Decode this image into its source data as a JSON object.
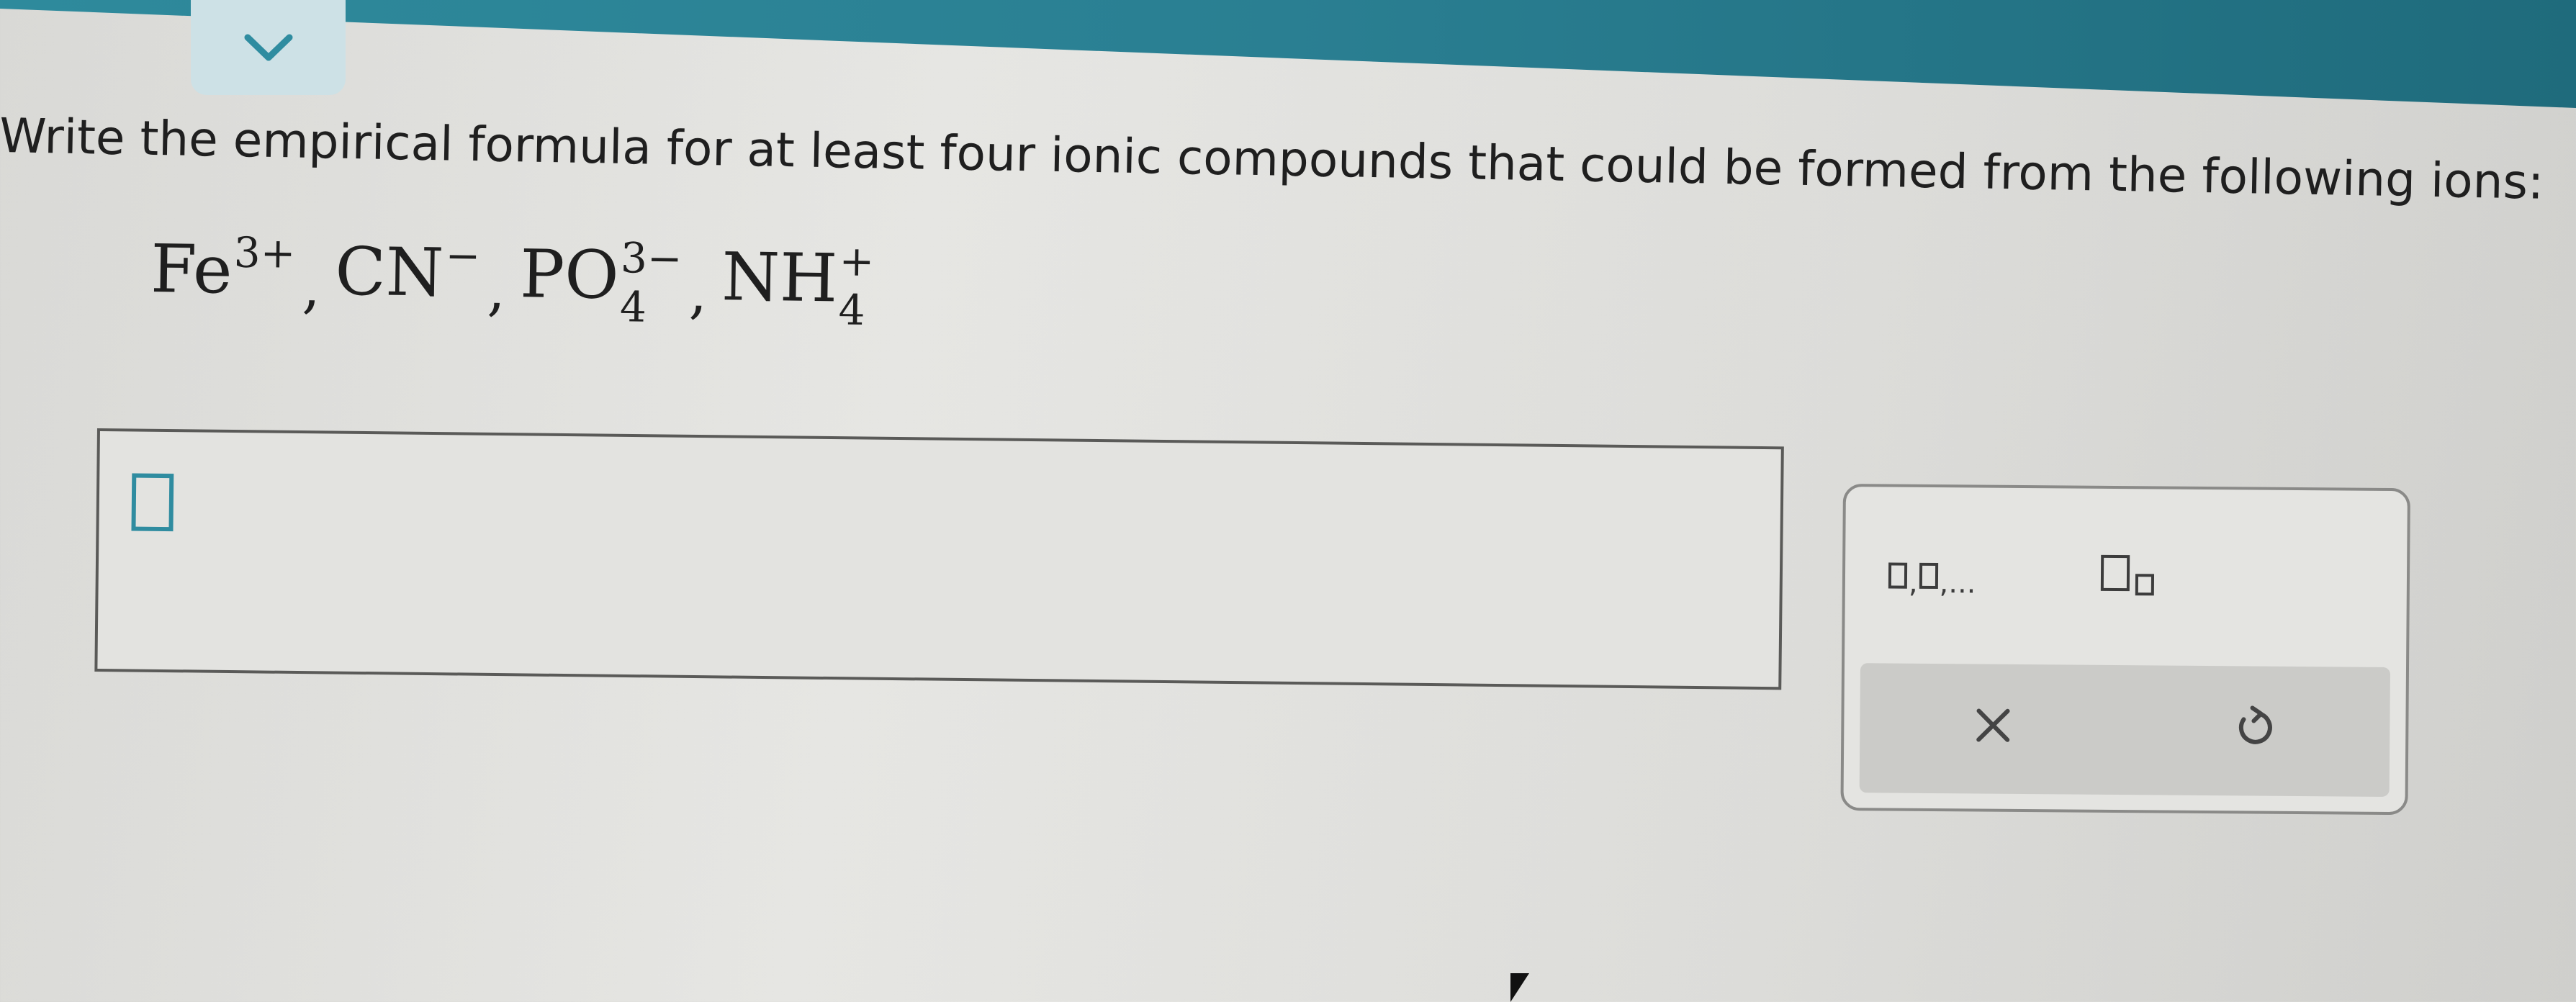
{
  "question": {
    "text": "Write the empirical formula for at least four ionic compounds that could be formed from the following ions:"
  },
  "ions": [
    {
      "base": "Fe",
      "charge": "3+",
      "subscript": ""
    },
    {
      "base": "CN",
      "charge": "−",
      "subscript": ""
    },
    {
      "base": "PO",
      "charge": "3−",
      "subscript": "4"
    },
    {
      "base": "NH",
      "charge": "+",
      "subscript": "4"
    }
  ],
  "separator": ",",
  "toolbar": {
    "list_tool_label": "□,□,...",
    "subscript_tool_icon": "subscript-box-icon",
    "clear_icon": "close-icon",
    "undo_icon": "undo-icon"
  },
  "colors": {
    "banner": "#2a7f92",
    "accent": "#2f8ca0"
  }
}
